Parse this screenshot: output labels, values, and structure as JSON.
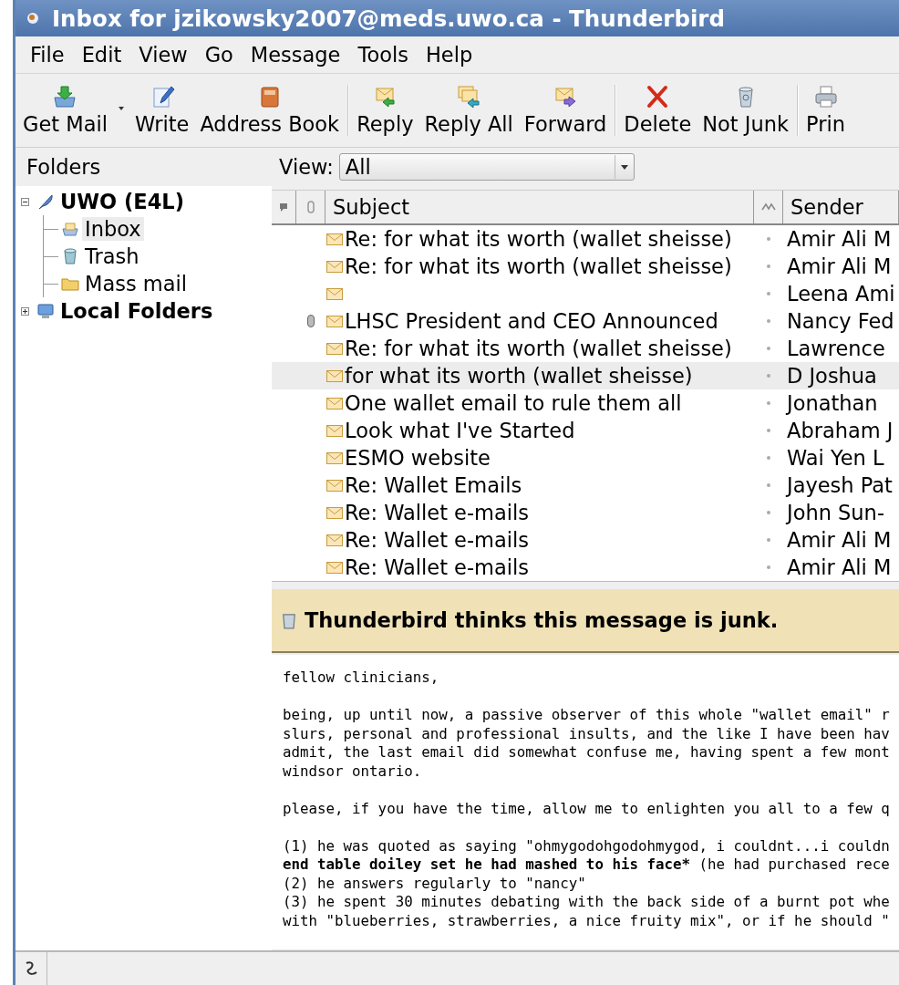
{
  "window": {
    "title": "Inbox for jzikowsky2007@meds.uwo.ca - Thunderbird"
  },
  "menu": [
    "File",
    "Edit",
    "View",
    "Go",
    "Message",
    "Tools",
    "Help"
  ],
  "toolbar": [
    {
      "buttons": [
        {
          "label": "Get Mail",
          "dropdown": true
        },
        {
          "label": "Write",
          "dropdown": false
        },
        {
          "label": "Address Book",
          "dropdown": false
        }
      ]
    },
    {
      "buttons": [
        {
          "label": "Reply",
          "dropdown": false
        },
        {
          "label": "Reply All",
          "dropdown": false
        },
        {
          "label": "Forward",
          "dropdown": false
        }
      ]
    },
    {
      "buttons": [
        {
          "label": "Delete",
          "dropdown": false
        },
        {
          "label": "Not Junk",
          "dropdown": false
        }
      ]
    },
    {
      "buttons": [
        {
          "label": "Prin",
          "dropdown": false
        }
      ]
    }
  ],
  "folders": {
    "title": "Folders",
    "tree": [
      {
        "label": "UWO (E4L)",
        "kind": "account",
        "expanded": true,
        "selected": false,
        "children": [
          {
            "label": "Inbox",
            "kind": "inbox",
            "selected": true
          },
          {
            "label": "Trash",
            "kind": "trash",
            "selected": false
          },
          {
            "label": "Mass mail",
            "kind": "folder",
            "selected": false
          }
        ]
      },
      {
        "label": "Local Folders",
        "kind": "local",
        "expanded": false,
        "selected": false
      }
    ]
  },
  "view": {
    "label": "View:",
    "value": "All"
  },
  "table": {
    "columns": [
      "Subject",
      "Sender"
    ],
    "rows": [
      {
        "subject": "Re: for what its worth (wallet sheisse)",
        "sender": "Amir Ali M",
        "attachment": false,
        "selected": false
      },
      {
        "subject": "Re: for what its worth (wallet sheisse)",
        "sender": "Amir Ali M",
        "attachment": false,
        "selected": false
      },
      {
        "sender": "Leena Ami",
        "attachment": false,
        "selected": false
      },
      {
        "subject": "LHSC President and CEO Announced",
        "sender": "Nancy Fed",
        "attachment": true,
        "selected": false
      },
      {
        "subject": "Re: for what its worth (wallet sheisse)",
        "sender": "Lawrence",
        "attachment": false,
        "selected": false
      },
      {
        "subject": "for what its worth (wallet sheisse)",
        "sender": "D Joshua",
        "attachment": false,
        "selected": true
      },
      {
        "subject": "One wallet email to rule them all",
        "sender": "Jonathan",
        "attachment": false,
        "selected": false
      },
      {
        "subject": "Look what I've Started",
        "sender": "Abraham J",
        "attachment": false,
        "selected": false
      },
      {
        "subject": "ESMO website",
        "sender": "Wai Yen L",
        "attachment": false,
        "selected": false
      },
      {
        "subject": "Re: Wallet Emails",
        "sender": "Jayesh Pat",
        "attachment": false,
        "selected": false
      },
      {
        "subject": "Re: Wallet e-mails",
        "sender": "John Sun-",
        "attachment": false,
        "selected": false
      },
      {
        "subject": "Re: Wallet e-mails",
        "sender": "Amir Ali M",
        "attachment": false,
        "selected": false
      },
      {
        "subject": "Re: Wallet e-mails",
        "sender": "Amir Ali M",
        "attachment": false,
        "selected": false
      }
    ]
  },
  "junk_bar": {
    "text": "Thunderbird thinks this message is junk."
  },
  "message_body": [
    {
      "lines": [
        {
          "text": "fellow clinicians,"
        }
      ]
    },
    {
      "lines": [
        {
          "text": "being, up until now, a passive observer of this whole \"wallet email\" r"
        },
        {
          "text": "slurs, personal and professional insults, and the like I have been hav"
        },
        {
          "text": "admit, the last email did somewhat confuse me, having spent a few mont"
        },
        {
          "text": "windsor ontario."
        }
      ]
    },
    {
      "lines": [
        {
          "text": "please, if you have the time, allow me to enlighten you all to a few q"
        }
      ]
    },
    {
      "lines": [
        {
          "text": "(1) he was quoted as saying \"ohmygodohgodohmygod, i couldnt...i couldn"
        },
        {
          "parts": [
            {
              "text": "end table doiley set he had mashed to his face*",
              "bold": true
            },
            {
              "text": " (he had purchased rece",
              "bold": false
            }
          ]
        },
        {
          "text": "(2) he answers regularly to \"nancy\""
        },
        {
          "text": "(3) he spent 30 minutes debating with the back side of a burnt pot whe"
        },
        {
          "text": "with \"blueberries, strawberries, a nice fruity mix\", or if he should \""
        }
      ]
    }
  ]
}
